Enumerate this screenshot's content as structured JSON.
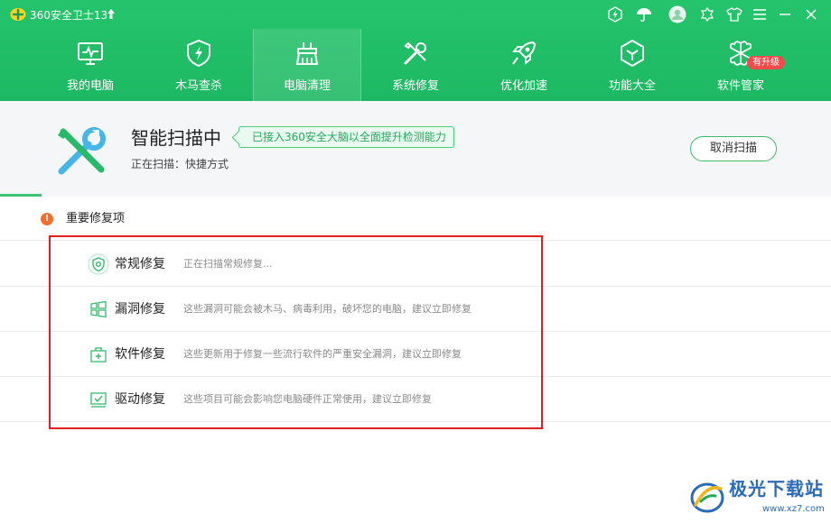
{
  "app": {
    "title": "360安全卫士13"
  },
  "nav": {
    "items": [
      {
        "label": "我的电脑",
        "icon": "monitor-icon"
      },
      {
        "label": "木马查杀",
        "icon": "shield-lightning-icon"
      },
      {
        "label": "电脑清理",
        "icon": "broom-icon"
      },
      {
        "label": "系统修复",
        "icon": "wrench-screwdriver-icon"
      },
      {
        "label": "优化加速",
        "icon": "rocket-icon"
      },
      {
        "label": "功能大全",
        "icon": "cube-icon"
      },
      {
        "label": "软件管家",
        "icon": "software-grid-icon"
      }
    ],
    "active_index": 2,
    "software_badge": "有升级"
  },
  "scan": {
    "title": "智能扫描中",
    "info_tag": "已接入360安全大脑以全面提升检测能力",
    "status_label": "正在扫描：",
    "status_mode": "快捷方式",
    "cancel_label": "取消扫描",
    "progress": 0.05
  },
  "section": {
    "title": "重要修复项",
    "warning_symbol": "!"
  },
  "rows": [
    {
      "name": "常规修复",
      "desc": "正在扫描常规修复...",
      "icon": "shield-scan-icon"
    },
    {
      "name": "漏洞修复",
      "desc": "这些漏洞可能会被木马、病毒利用，破坏您的电脑，建议立即修复",
      "icon": "windows-icon"
    },
    {
      "name": "软件修复",
      "desc": "这些更新用于修复一些流行软件的严重安全漏洞，建议立即修复",
      "icon": "software-box-icon"
    },
    {
      "name": "驱动修复",
      "desc": "这些项目可能会影响您电脑硬件正常使用，建议立即修复",
      "icon": "driver-icon"
    }
  ],
  "watermark": {
    "text": "极光下载站",
    "url": "www.xz7.com"
  },
  "colors": {
    "header_green": "#1db863",
    "accent_green": "#3dc473",
    "highlight_red": "#e02020",
    "warning_orange": "#f56d2e",
    "watermark_blue": "#2c6bb8"
  }
}
